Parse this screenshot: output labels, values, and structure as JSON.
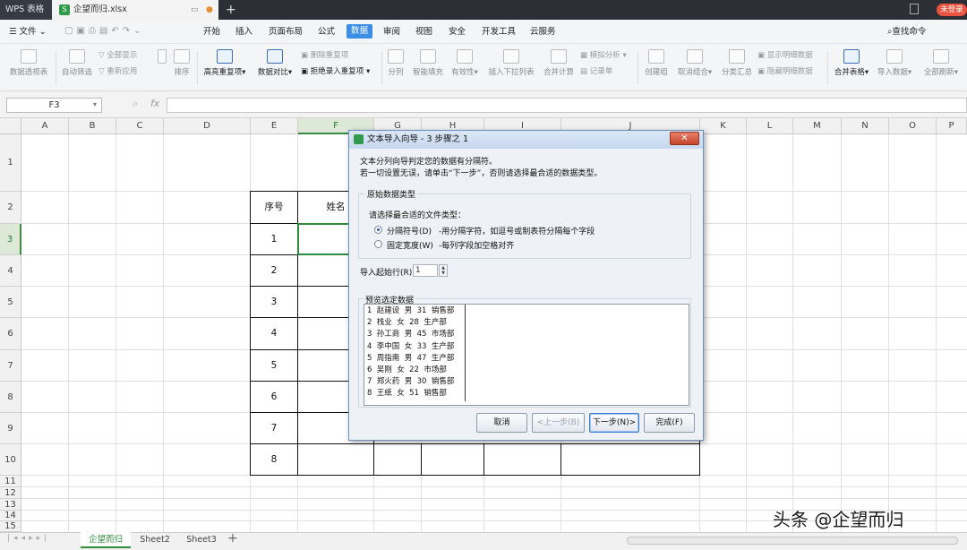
{
  "titlebar": {
    "app_tab": "WPS 表格",
    "file_tab": "企望而归.xlsx",
    "login": "未登录"
  },
  "menubar": {
    "file": "文件",
    "tabs": [
      "开始",
      "插入",
      "页面布局",
      "公式",
      "数据",
      "审阅",
      "视图",
      "安全",
      "开发工具",
      "云服务"
    ],
    "active_tab": "数据",
    "search": "查找命令"
  },
  "ribbon": {
    "pivot": "数据透视表",
    "auto_filter": "自动筛选",
    "show_all": "全部显示",
    "reapply": "重新应用",
    "sort": "排序",
    "highlight_dup": "高亮重复项",
    "data_compare": "数据对比",
    "delete_dup": "删除重复项",
    "reject_dup": "拒绝录入重复项",
    "split": "分列",
    "smart_fill": "智能填充",
    "validity": "有效性",
    "insert_dropdown": "插入下拉列表",
    "merge_calc": "合并计算",
    "simulate": "模拟分析",
    "record": "记录单",
    "group": "创建组",
    "ungroup": "取消组合",
    "subtotal": "分类汇总",
    "show_detail": "显示明细数据",
    "hide_detail": "隐藏明细数据",
    "merge_table": "合并表格",
    "import_data": "导入数据",
    "refresh_all": "全部刷新"
  },
  "formula_bar": {
    "cell_ref": "F3",
    "fx": "fx"
  },
  "grid": {
    "columns": [
      "A",
      "B",
      "C",
      "D",
      "E",
      "F",
      "G",
      "H",
      "I",
      "J",
      "K",
      "L",
      "M",
      "N",
      "O",
      "P"
    ],
    "rows": [
      "1",
      "2",
      "3",
      "4",
      "5",
      "6",
      "7",
      "8",
      "9",
      "10",
      "11",
      "12",
      "13",
      "14",
      "15"
    ],
    "selected_col": "F",
    "selected_row": "3",
    "table_header": {
      "seq": "序号",
      "name": "姓名"
    },
    "seq_numbers": [
      "1",
      "2",
      "3",
      "4",
      "5",
      "6",
      "7",
      "8"
    ]
  },
  "sheets": [
    "企望而归",
    "Sheet2",
    "Sheet3"
  ],
  "active_sheet": "企望而归",
  "watermark": "头条 @企望而归",
  "dialog": {
    "title": "文本导入向导 - 3 步骤之 1",
    "intro1": "文本分列向导判定您的数据有分隔符。",
    "intro2": "若一切设置无误，请单击“下一步”，否则请选择最合适的数据类型。",
    "group_title": "原始数据类型",
    "choose": "请选择最合适的文件类型：",
    "opt1_label": "分隔符号(D)",
    "opt1_desc": "-用分隔字符，如逗号或制表符分隔每个字段",
    "opt2_label": "固定宽度(W)",
    "opt2_desc": "-每列字段加空格对齐",
    "selected_option": "分隔符号(D)",
    "start_row_label": "导入起始行(R):",
    "start_row_value": "1",
    "preview_title": "预览选定数据",
    "preview_lines": [
      "1  赵建设  男  31  销售部",
      "2  栈业  女  28  生产部",
      "3  孙工商  男  45  市场部",
      "4  李中国  女  33  生产部",
      "5  周指南  男  47  生产部",
      "6  吴刚  女  22  市场部",
      "7  郑火药  男  30  销售部",
      "8  王纸  女  51  销售部"
    ],
    "buttons": {
      "cancel": "取消",
      "back": "<上一步(B)",
      "next": "下一步(N)>",
      "finish": "完成(F)"
    }
  }
}
